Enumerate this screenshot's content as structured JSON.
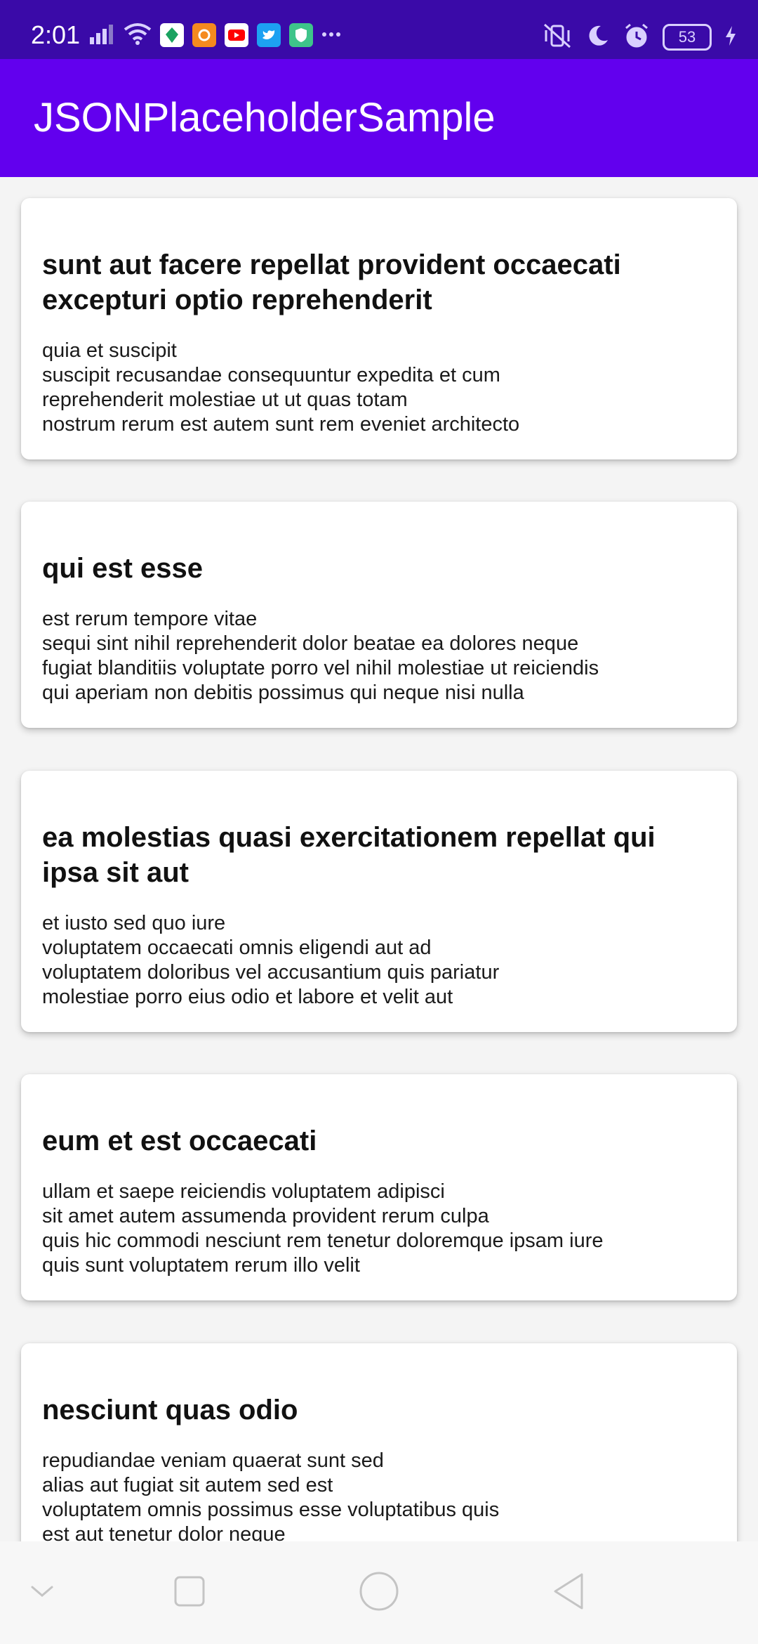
{
  "status_bar": {
    "time": "2:01",
    "battery": "53",
    "left_icons": [
      "signal-icon",
      "wifi-icon",
      "maps-app-icon",
      "swiggy-app-icon",
      "youtube-app-icon",
      "twitter-app-icon",
      "shield-app-icon",
      "more-dots-icon"
    ],
    "right_icons": [
      "vibrate-off-icon",
      "moon-icon",
      "alarm-icon",
      "battery-icon",
      "charging-icon"
    ]
  },
  "app_bar": {
    "title": "JSONPlaceholderSample",
    "color": "#6200ee"
  },
  "posts": [
    {
      "title": "sunt aut facere repellat provident occaecati excepturi optio reprehenderit",
      "body": "quia et suscipit\nsuscipit recusandae consequuntur expedita et cum\nreprehenderit molestiae ut ut quas totam\nnostrum rerum est autem sunt rem eveniet architecto"
    },
    {
      "title": "qui est esse",
      "body": "est rerum tempore vitae\nsequi sint nihil reprehenderit dolor beatae ea dolores neque\nfugiat blanditiis voluptate porro vel nihil molestiae ut reiciendis\nqui aperiam non debitis possimus qui neque nisi nulla"
    },
    {
      "title": "ea molestias quasi exercitationem repellat qui ipsa sit aut",
      "body": "et iusto sed quo iure\nvoluptatem occaecati omnis eligendi aut ad\nvoluptatem doloribus vel accusantium quis pariatur\nmolestiae porro eius odio et labore et velit aut"
    },
    {
      "title": "eum et est occaecati",
      "body": "ullam et saepe reiciendis voluptatem adipisci\nsit amet autem assumenda provident rerum culpa\nquis hic commodi nesciunt rem tenetur doloremque ipsam iure\nquis sunt voluptatem rerum illo velit"
    },
    {
      "title": "nesciunt quas odio",
      "body": "repudiandae veniam quaerat sunt sed\nalias aut fugiat sit autem sed est\nvoluptatem omnis possimus esse voluptatibus quis\nest aut tenetur dolor neque"
    }
  ],
  "nav_bar": {
    "buttons": [
      "chevron-down-icon",
      "recents-square-icon",
      "home-circle-icon",
      "back-triangle-icon"
    ]
  }
}
